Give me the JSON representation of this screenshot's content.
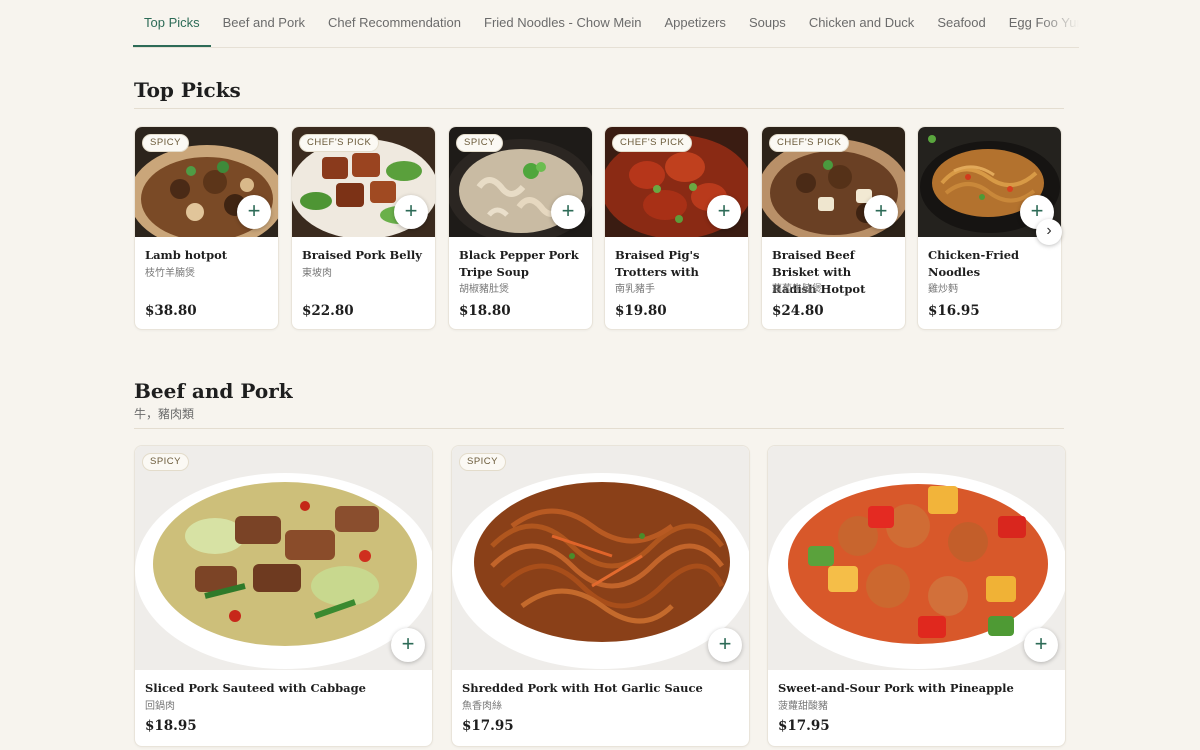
{
  "tabs": [
    {
      "label": "Top Picks",
      "active": true
    },
    {
      "label": "Beef and Pork",
      "active": false
    },
    {
      "label": "Chef Recommendation",
      "active": false
    },
    {
      "label": "Fried Noodles - Chow Mein",
      "active": false
    },
    {
      "label": "Appetizers",
      "active": false
    },
    {
      "label": "Soups",
      "active": false
    },
    {
      "label": "Chicken and Duck",
      "active": false
    },
    {
      "label": "Seafood",
      "active": false
    },
    {
      "label": "Egg Foo Yung",
      "active": false
    }
  ],
  "top_picks": {
    "title": "Top Picks",
    "items": [
      {
        "badge": "SPICY",
        "name": "Lamb hotpot",
        "name_cn": "枝竹羊腩煲",
        "price": "$38.80"
      },
      {
        "badge": "CHEF'S PICK",
        "name": "Braised Pork Belly",
        "name_cn": "東坡肉",
        "price": "$22.80"
      },
      {
        "badge": "SPICY",
        "name": "Black Pepper Pork Tripe Soup",
        "name_cn": "胡椒豬肚煲",
        "price": "$18.80"
      },
      {
        "badge": "CHEF'S PICK",
        "name": "Braised Pig's Trotters with Fermented Red...",
        "name_cn": "南乳豬手",
        "price": "$19.80"
      },
      {
        "badge": "CHEF'S PICK",
        "name": "Braised Beef Brisket with Radish Hotpot",
        "name_cn": "蘿蔔牛腩煲",
        "price": "$24.80"
      },
      {
        "badge": "",
        "name": "Chicken-Fried Noodles",
        "name_cn": "雞炒麪",
        "price": "$16.95"
      }
    ],
    "next_icon": "›"
  },
  "beef_pork": {
    "title": "Beef and Pork",
    "subtitle": "牛，豬肉類",
    "items": [
      {
        "badge": "SPICY",
        "name": "Sliced Pork Sauteed with Cabbage",
        "name_cn": "回鍋肉",
        "price": "$18.95"
      },
      {
        "badge": "SPICY",
        "name": "Shredded Pork with Hot Garlic Sauce",
        "name_cn": "魚香肉絲",
        "price": "$17.95"
      },
      {
        "badge": "",
        "name": "Sweet-and-Sour Pork with Pineapple",
        "name_cn": "菠蘿甜酸豬",
        "price": "$17.95"
      }
    ]
  },
  "add_icon": "+",
  "colors": {
    "accent": "#2d6b57",
    "background": "#f7f4ee"
  }
}
